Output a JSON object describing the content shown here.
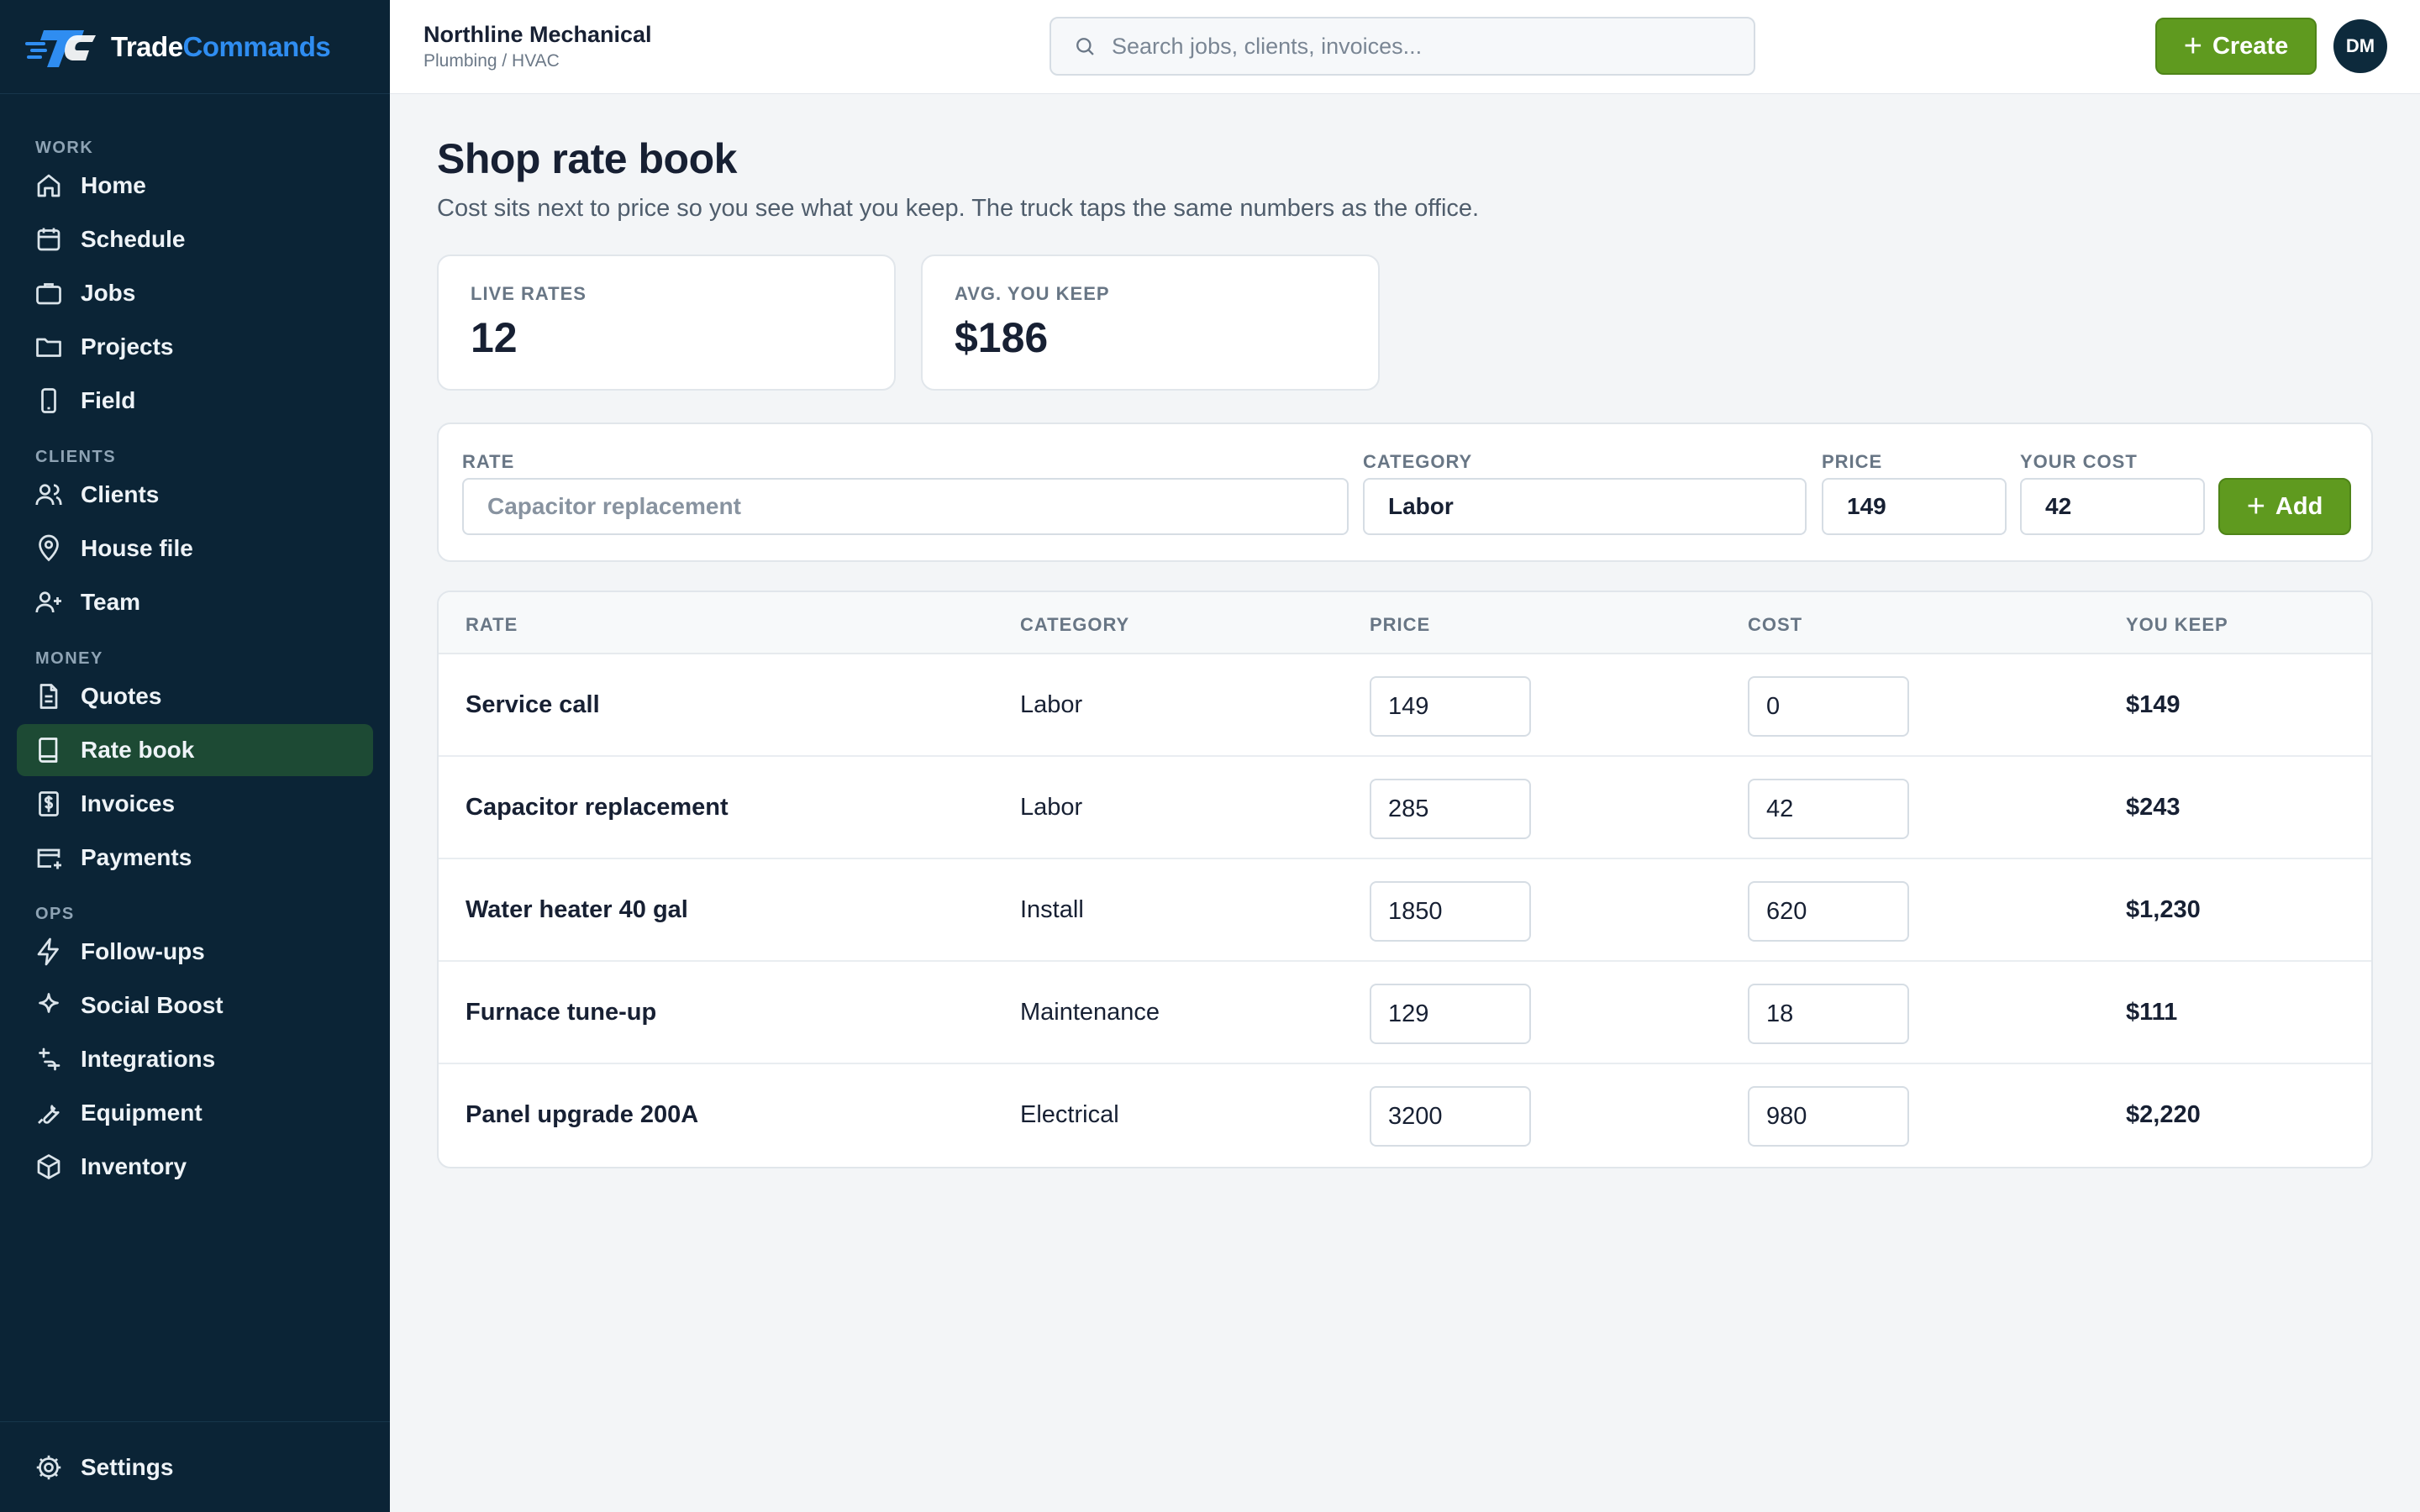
{
  "app": {
    "name_part1": "Trade",
    "name_part2": "Commands"
  },
  "header": {
    "org_name": "Northline Mechanical",
    "org_trade": "Plumbing / HVAC",
    "search_placeholder": "Search jobs, clients, invoices...",
    "create_label": "Create",
    "avatar_initials": "DM"
  },
  "sidebar": {
    "sections": [
      {
        "label": "WORK",
        "items": [
          {
            "label": "Home",
            "icon": "home-icon"
          },
          {
            "label": "Schedule",
            "icon": "calendar-icon"
          },
          {
            "label": "Jobs",
            "icon": "briefcase-icon"
          },
          {
            "label": "Projects",
            "icon": "folder-icon"
          },
          {
            "label": "Field",
            "icon": "phone-icon"
          }
        ]
      },
      {
        "label": "CLIENTS",
        "items": [
          {
            "label": "Clients",
            "icon": "users-icon"
          },
          {
            "label": "House file",
            "icon": "map-pin-icon"
          },
          {
            "label": "Team",
            "icon": "user-plus-icon"
          }
        ]
      },
      {
        "label": "MONEY",
        "items": [
          {
            "label": "Quotes",
            "icon": "file-text-icon"
          },
          {
            "label": "Rate book",
            "icon": "book-icon",
            "active": true
          },
          {
            "label": "Invoices",
            "icon": "dollar-receipt-icon"
          },
          {
            "label": "Payments",
            "icon": "card-plus-icon"
          }
        ]
      },
      {
        "label": "OPS",
        "items": [
          {
            "label": "Follow-ups",
            "icon": "zap-icon"
          },
          {
            "label": "Social Boost",
            "icon": "sparkle-icon"
          },
          {
            "label": "Integrations",
            "icon": "integration-icon"
          },
          {
            "label": "Equipment",
            "icon": "wrench-icon"
          },
          {
            "label": "Inventory",
            "icon": "box-icon"
          }
        ]
      }
    ],
    "settings_label": "Settings"
  },
  "page": {
    "title": "Shop rate book",
    "subtitle": "Cost sits next to price so you see what you keep. The truck taps the same numbers as the office."
  },
  "stats": [
    {
      "label": "LIVE RATES",
      "value": "12"
    },
    {
      "label": "AVG. YOU KEEP",
      "value": "$186"
    }
  ],
  "form": {
    "rate_label": "RATE",
    "rate_placeholder": "Capacitor replacement",
    "category_label": "CATEGORY",
    "category_value": "Labor",
    "price_label": "PRICE",
    "price_value": "149",
    "cost_label": "YOUR COST",
    "cost_value": "42",
    "add_label": "Add"
  },
  "table": {
    "columns": [
      "RATE",
      "CATEGORY",
      "PRICE",
      "COST",
      "YOU KEEP"
    ],
    "rows": [
      {
        "rate": "Service call",
        "category": "Labor",
        "price": "149",
        "cost": "0",
        "keep": "$149"
      },
      {
        "rate": "Capacitor replacement",
        "category": "Labor",
        "price": "285",
        "cost": "42",
        "keep": "$243"
      },
      {
        "rate": "Water heater 40 gal",
        "category": "Install",
        "price": "1850",
        "cost": "620",
        "keep": "$1,230"
      },
      {
        "rate": "Furnace tune-up",
        "category": "Maintenance",
        "price": "129",
        "cost": "18",
        "keep": "$111"
      },
      {
        "rate": "Panel upgrade 200A",
        "category": "Electrical",
        "price": "3200",
        "cost": "980",
        "keep": "$2,220"
      }
    ]
  },
  "colors": {
    "sidebar_bg": "#0b2436",
    "active_nav_bg": "#1d4a34",
    "accent_green": "#5f9a1f",
    "brand_blue": "#2f8df1"
  }
}
